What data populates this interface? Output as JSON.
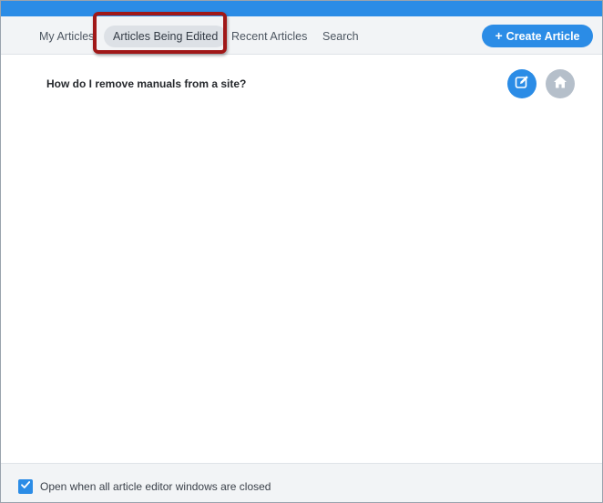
{
  "tabs": [
    {
      "label": "My Articles"
    },
    {
      "label": "Articles Being Edited"
    },
    {
      "label": "Recent Articles"
    },
    {
      "label": "Search"
    }
  ],
  "active_tab": "Articles Being Edited",
  "create_button": {
    "label": "Create Article",
    "icon": "plus-icon"
  },
  "articles": [
    {
      "title": "How do I remove manuals from a site?",
      "actions": [
        "edit-icon",
        "home-icon"
      ]
    }
  ],
  "footer": {
    "checkbox_checked": true,
    "label": "Open when all article editor windows are closed"
  },
  "colors": {
    "accent": "#2b8ce6",
    "highlight_border": "#a01818",
    "home_button": "#b5bfca"
  }
}
